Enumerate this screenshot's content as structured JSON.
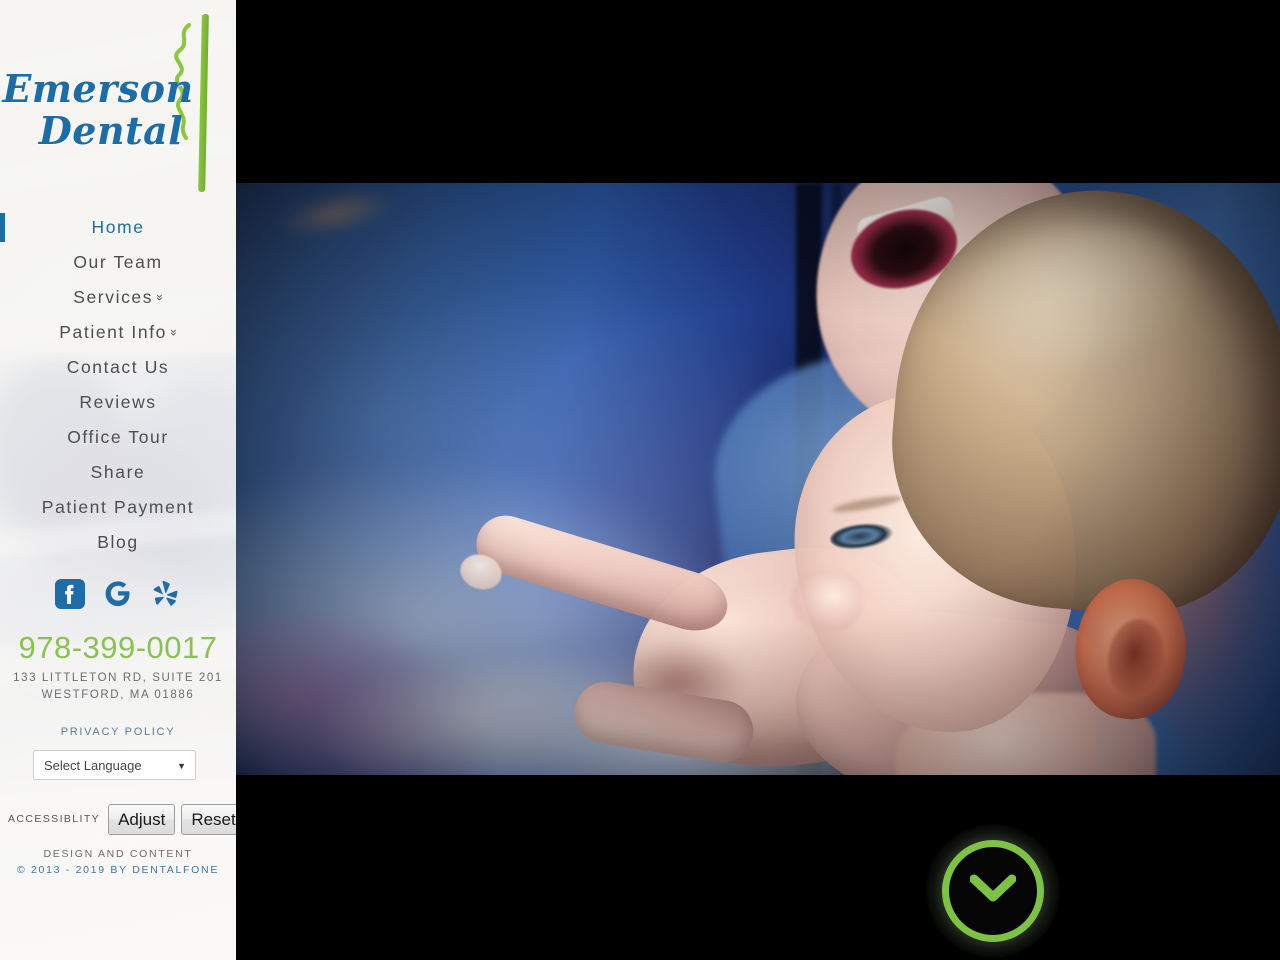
{
  "site": {
    "logo": {
      "line1": "Emerson",
      "line2": "Dental",
      "accent_green": "#8cc63f",
      "text_blue": "#1c6ca8"
    }
  },
  "nav": {
    "items": [
      {
        "label": "Home",
        "active": true,
        "has_dropdown": false
      },
      {
        "label": "Our Team",
        "active": false,
        "has_dropdown": false
      },
      {
        "label": "Services",
        "active": false,
        "has_dropdown": true
      },
      {
        "label": "Patient Info",
        "active": false,
        "has_dropdown": true
      },
      {
        "label": "Contact Us",
        "active": false,
        "has_dropdown": false
      },
      {
        "label": "Reviews",
        "active": false,
        "has_dropdown": false
      },
      {
        "label": "Office Tour",
        "active": false,
        "has_dropdown": false
      },
      {
        "label": "Share",
        "active": false,
        "has_dropdown": false
      },
      {
        "label": "Patient Payment",
        "active": false,
        "has_dropdown": false
      },
      {
        "label": "Blog",
        "active": false,
        "has_dropdown": false
      }
    ],
    "dropdown_glyph": "»"
  },
  "social": {
    "items": [
      {
        "name": "facebook-icon",
        "label": "Facebook"
      },
      {
        "name": "google-icon",
        "label": "Google"
      },
      {
        "name": "yelp-icon",
        "label": "Yelp"
      }
    ],
    "color": "#1e6ca8"
  },
  "contact": {
    "phone": "978-399-0017",
    "phone_color": "#8cc152",
    "address_line1": "133 LITTLETON RD, SUITE 201",
    "address_line2": "WESTFORD, MA 01886"
  },
  "footer": {
    "privacy_policy": "PRIVACY POLICY",
    "language": {
      "selected": "Select Language",
      "options": [
        "Select Language"
      ],
      "arrow": "▼"
    },
    "accessibility": {
      "label": "ACCESSIBLITY",
      "adjust_button": "Adjust",
      "reset_button": "Reset"
    },
    "credit_line1": "DESIGN AND CONTENT",
    "credit_line2": "© 2013 - 2019 BY DENTALFONE"
  },
  "hero": {
    "alt": "Mother and young girl looking in awe at an aquarium; girl points at the glass",
    "background_color": "#000000",
    "scroll_button": {
      "name": "scroll-down-button",
      "glyph": "⌄",
      "ring_color": "#7dc242"
    }
  }
}
